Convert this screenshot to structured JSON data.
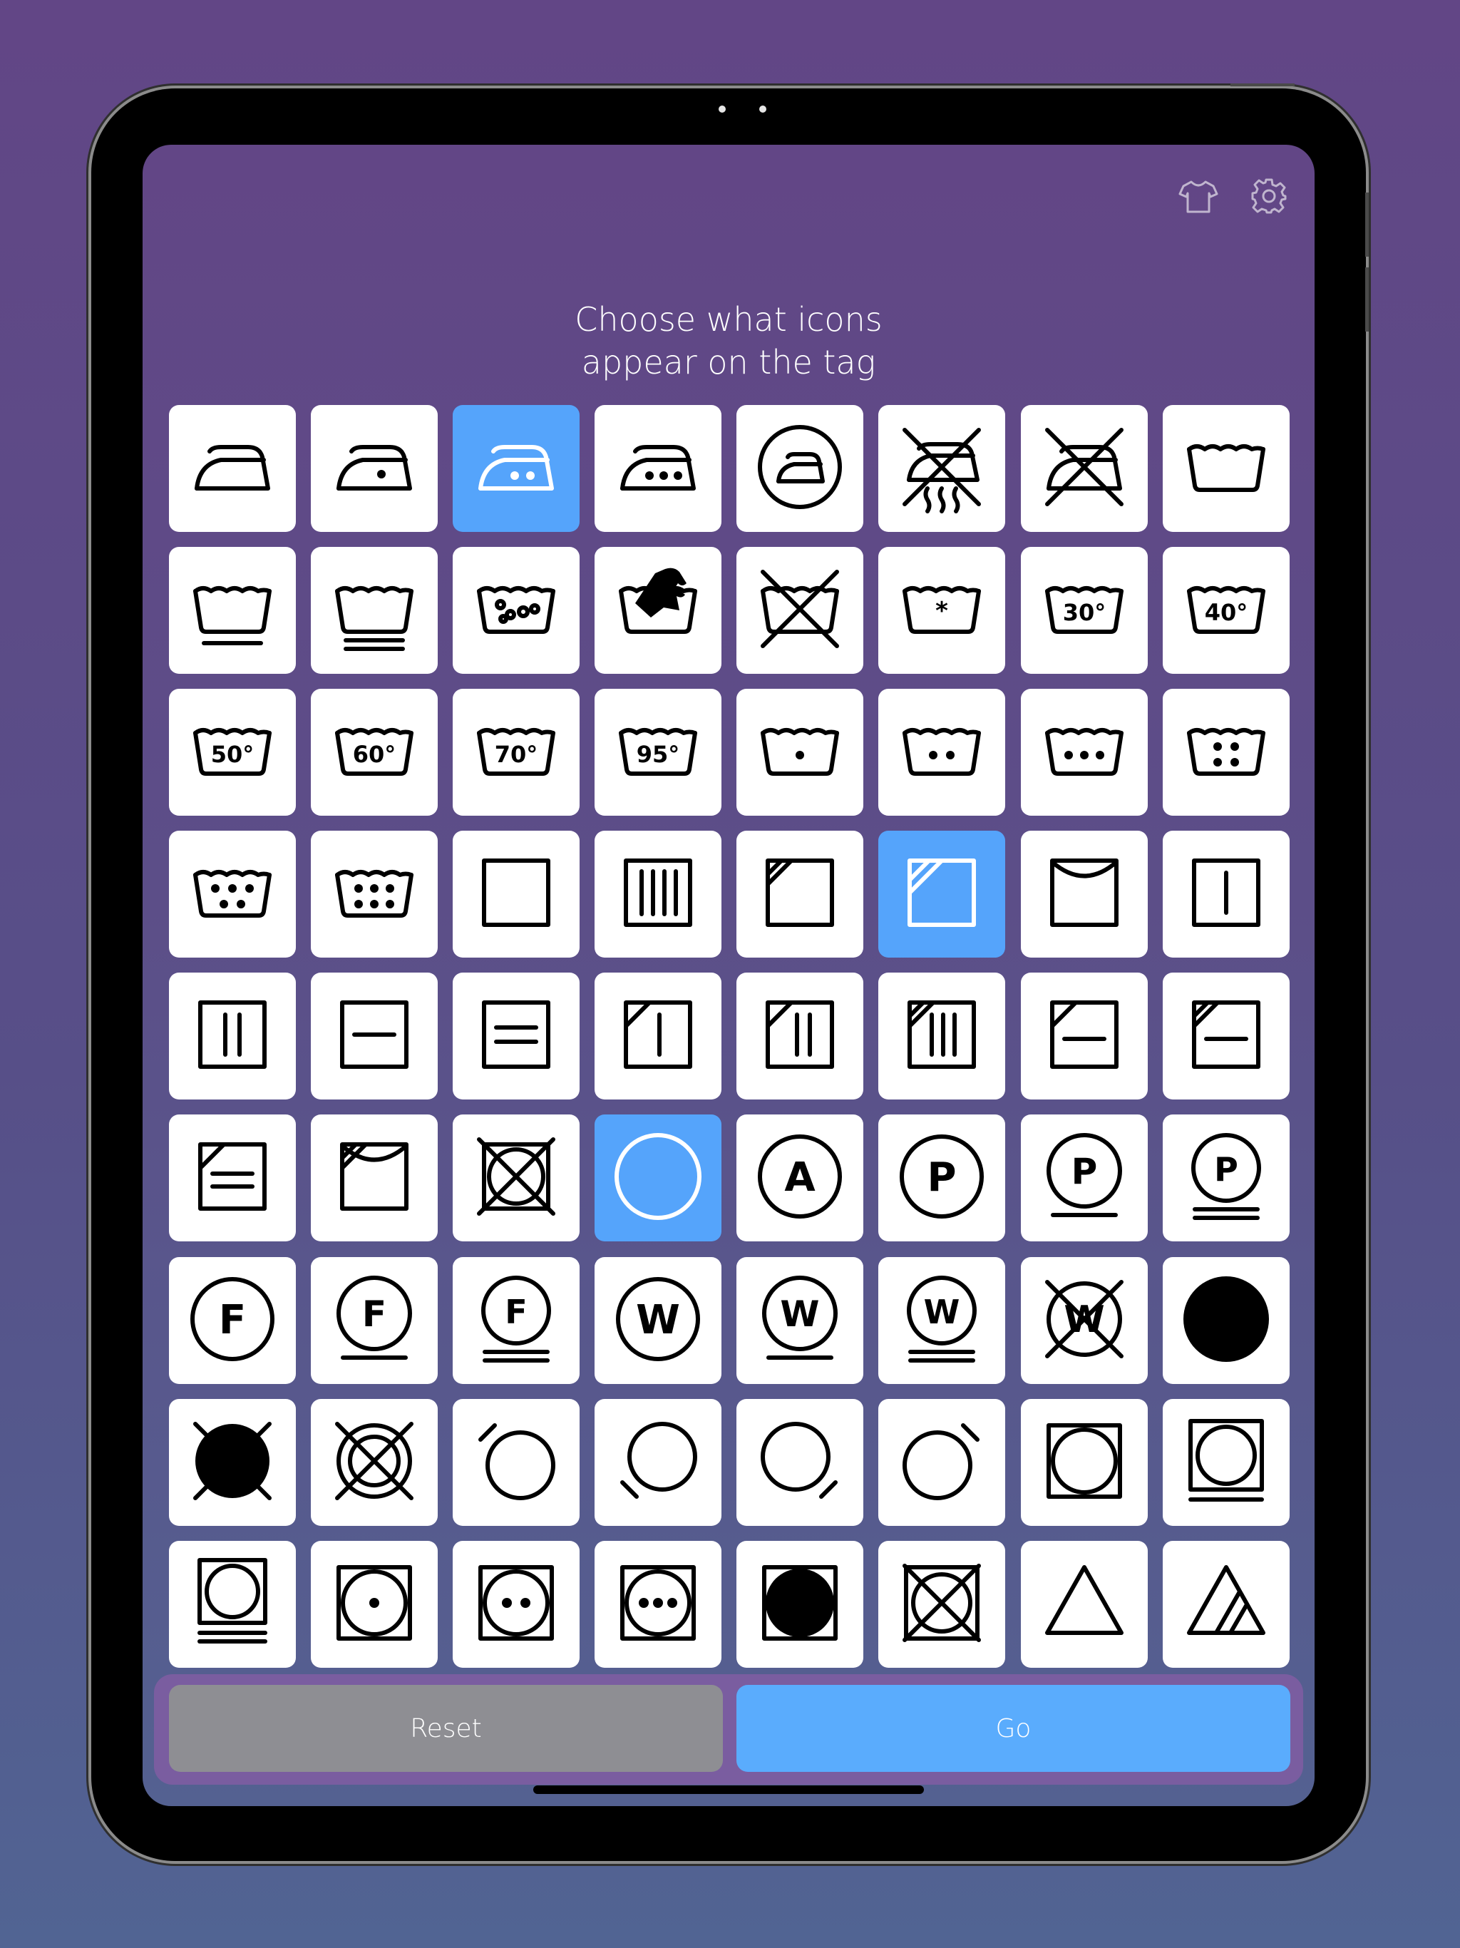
{
  "header": {
    "title_line1": "Choose what icons",
    "title_line2": "appear on the tag",
    "icons": [
      "tshirt-icon",
      "gear-icon"
    ]
  },
  "colors": {
    "background_top": "#624686",
    "background_bottom": "#516493",
    "tile": "#ffffff",
    "tile_selected": "#55a4fb",
    "reset_button": "#8e8e93",
    "go_button": "#5aacfd"
  },
  "symbols": [
    {
      "name": "iron-low-icon",
      "selected": false
    },
    {
      "name": "iron-one-dot-icon",
      "selected": false
    },
    {
      "name": "iron-two-dots-icon",
      "selected": true
    },
    {
      "name": "iron-three-dots-icon",
      "selected": false
    },
    {
      "name": "iron-in-circle-icon",
      "selected": false
    },
    {
      "name": "no-steam-iron-icon",
      "selected": false
    },
    {
      "name": "do-not-iron-icon",
      "selected": false
    },
    {
      "name": "wash-tub-icon",
      "selected": false
    },
    {
      "name": "wash-permanent-press-icon",
      "selected": false
    },
    {
      "name": "wash-delicate-icon",
      "selected": false
    },
    {
      "name": "wash-bubbles-icon",
      "selected": false
    },
    {
      "name": "hand-wash-icon",
      "selected": false
    },
    {
      "name": "do-not-wash-icon",
      "selected": false
    },
    {
      "name": "wash-any-temperature-icon",
      "selected": false
    },
    {
      "name": "wash-30-icon",
      "label": "30°",
      "selected": false
    },
    {
      "name": "wash-40-icon",
      "label": "40°",
      "selected": false
    },
    {
      "name": "wash-50-icon",
      "label": "50°",
      "selected": false
    },
    {
      "name": "wash-60-icon",
      "label": "60°",
      "selected": false
    },
    {
      "name": "wash-70-icon",
      "label": "70°",
      "selected": false
    },
    {
      "name": "wash-95-icon",
      "label": "95°",
      "selected": false
    },
    {
      "name": "wash-one-dot-icon",
      "selected": false
    },
    {
      "name": "wash-two-dots-icon",
      "selected": false
    },
    {
      "name": "wash-three-dots-icon",
      "selected": false
    },
    {
      "name": "wash-four-dots-icon",
      "selected": false
    },
    {
      "name": "wash-five-dots-icon",
      "selected": false
    },
    {
      "name": "wash-six-dots-icon",
      "selected": false
    },
    {
      "name": "dry-square-icon",
      "selected": false
    },
    {
      "name": "drip-dry-icon",
      "selected": false
    },
    {
      "name": "dry-in-shade-icon",
      "selected": false
    },
    {
      "name": "dry-in-shade-double-icon",
      "selected": true
    },
    {
      "name": "line-dry-icon",
      "selected": false
    },
    {
      "name": "drip-dry-single-line-icon",
      "selected": false
    },
    {
      "name": "drip-dry-two-lines-icon",
      "selected": false
    },
    {
      "name": "dry-flat-icon",
      "selected": false
    },
    {
      "name": "dry-flat-double-icon",
      "selected": false
    },
    {
      "name": "drip-dry-shade-icon",
      "selected": false
    },
    {
      "name": "drip-dry-two-lines-shade-icon",
      "selected": false
    },
    {
      "name": "drip-dry-shade-double-icon",
      "selected": false
    },
    {
      "name": "dry-flat-shade-icon",
      "selected": false
    },
    {
      "name": "dry-flat-shade-double-icon",
      "selected": false
    },
    {
      "name": "dry-flat-double-lines-shade-icon",
      "selected": false
    },
    {
      "name": "line-dry-shade-icon",
      "selected": false
    },
    {
      "name": "do-not-dry-icon",
      "selected": false
    },
    {
      "name": "dry-clean-icon",
      "selected": true
    },
    {
      "name": "dry-clean-any-solvent-icon",
      "label": "A",
      "selected": false
    },
    {
      "name": "dry-clean-p-icon",
      "label": "P",
      "selected": false
    },
    {
      "name": "dry-clean-p-gentle-icon",
      "label": "P",
      "selected": false
    },
    {
      "name": "dry-clean-p-very-gentle-icon",
      "label": "P",
      "selected": false
    },
    {
      "name": "dry-clean-f-icon",
      "label": "F",
      "selected": false
    },
    {
      "name": "dry-clean-f-gentle-icon",
      "label": "F",
      "selected": false
    },
    {
      "name": "dry-clean-f-very-gentle-icon",
      "label": "F",
      "selected": false
    },
    {
      "name": "wet-clean-w-icon",
      "label": "W",
      "selected": false
    },
    {
      "name": "wet-clean-w-gentle-icon",
      "label": "W",
      "selected": false
    },
    {
      "name": "wet-clean-w-very-gentle-icon",
      "label": "W",
      "selected": false
    },
    {
      "name": "do-not-wet-clean-icon",
      "label": "W",
      "selected": false
    },
    {
      "name": "filled-circle-icon",
      "selected": false
    },
    {
      "name": "do-not-dry-clean-filled-icon",
      "selected": false
    },
    {
      "name": "do-not-dry-clean-icon",
      "selected": false
    },
    {
      "name": "circle-bar-top-left-icon",
      "selected": false
    },
    {
      "name": "circle-bar-bottom-left-icon",
      "selected": false
    },
    {
      "name": "circle-bar-bottom-right-icon",
      "selected": false
    },
    {
      "name": "circle-bar-top-right-icon",
      "selected": false
    },
    {
      "name": "tumble-dry-icon",
      "selected": false
    },
    {
      "name": "tumble-dry-permanent-press-icon",
      "selected": false
    },
    {
      "name": "tumble-dry-gentle-icon",
      "selected": false
    },
    {
      "name": "tumble-dry-low-icon",
      "selected": false
    },
    {
      "name": "tumble-dry-medium-icon",
      "selected": false
    },
    {
      "name": "tumble-dry-high-icon",
      "selected": false
    },
    {
      "name": "tumble-dry-no-heat-icon",
      "selected": false
    },
    {
      "name": "do-not-tumble-dry-icon",
      "selected": false
    },
    {
      "name": "bleach-triangle-icon",
      "selected": false
    },
    {
      "name": "non-chlorine-bleach-icon",
      "selected": false
    }
  ],
  "actions": {
    "reset_label": "Reset",
    "go_label": "Go"
  }
}
